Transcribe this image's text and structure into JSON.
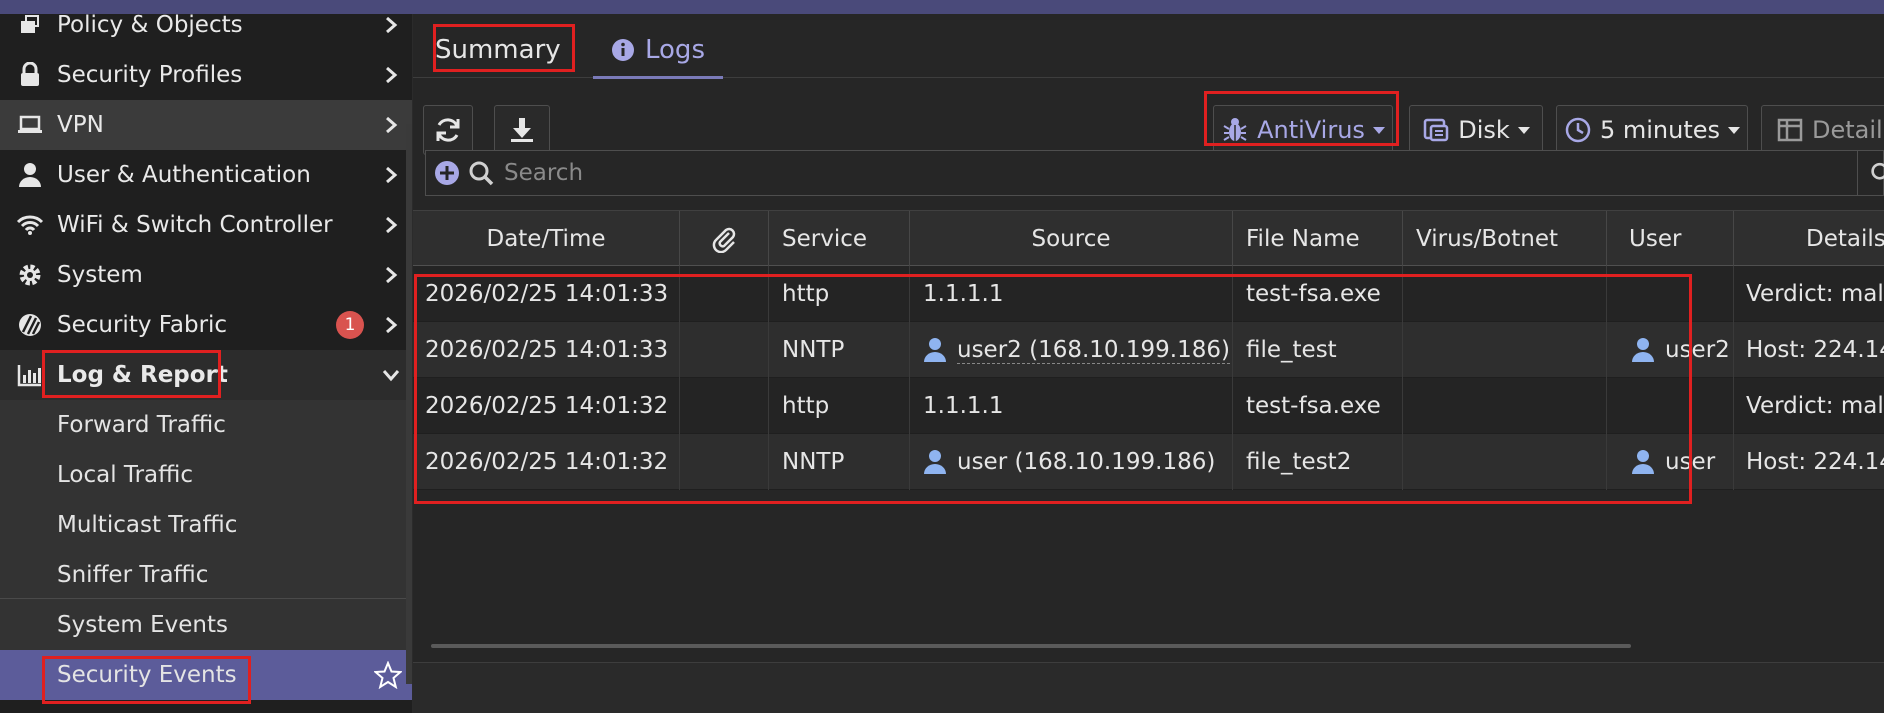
{
  "sidebar": {
    "items": [
      {
        "label": "Policy & Objects",
        "icon": "policy-icon"
      },
      {
        "label": "Security Profiles",
        "icon": "lock-icon"
      },
      {
        "label": "VPN",
        "icon": "laptop-icon"
      },
      {
        "label": "User & Authentication",
        "icon": "user-icon"
      },
      {
        "label": "WiFi & Switch Controller",
        "icon": "wifi-icon"
      },
      {
        "label": "System",
        "icon": "gear-icon"
      },
      {
        "label": "Security Fabric",
        "icon": "fabric-icon",
        "badge": "1"
      },
      {
        "label": "Log & Report",
        "icon": "chart-icon"
      }
    ],
    "sub_items": [
      {
        "label": "Forward Traffic"
      },
      {
        "label": "Local Traffic"
      },
      {
        "label": "Multicast Traffic"
      },
      {
        "label": "Sniffer Traffic"
      },
      {
        "label": "System Events"
      },
      {
        "label": "Security Events"
      }
    ]
  },
  "tabs": {
    "summary": "Summary",
    "logs": "Logs"
  },
  "toolbar": {
    "antivirus": "AntiVirus",
    "disk": "Disk",
    "time": "5 minutes",
    "details": "Details"
  },
  "search": {
    "placeholder": "Search"
  },
  "table": {
    "columns": [
      "Date/Time",
      "",
      "Service",
      "Source",
      "File Name",
      "Virus/Botnet",
      "User",
      "Details"
    ],
    "rows": [
      {
        "datetime": "2026/02/25 14:01:33",
        "service": "http",
        "source": "1.1.1.1",
        "source_user": false,
        "file": "test-fsa.exe",
        "virus": "",
        "user": "",
        "details": "Verdict: malic"
      },
      {
        "datetime": "2026/02/25 14:01:33",
        "service": "NNTP",
        "source": "user2 (168.10.199.186)",
        "source_user": true,
        "file": "file_test",
        "virus": "",
        "user": "user2",
        "details": "Host: 224.14"
      },
      {
        "datetime": "2026/02/25 14:01:32",
        "service": "http",
        "source": "1.1.1.1",
        "source_user": false,
        "file": "test-fsa.exe",
        "virus": "",
        "user": "",
        "details": "Verdict: malic"
      },
      {
        "datetime": "2026/02/25 14:01:32",
        "service": "NNTP",
        "source": "user (168.10.199.186)",
        "source_user": true,
        "file": "file_test2",
        "virus": "",
        "user": "user",
        "details": "Host: 224.14"
      }
    ]
  },
  "colors": {
    "accent": "#a8a8e6",
    "active_nav": "#5c5c9a",
    "badge": "#d9534f",
    "highlight": "#e02020",
    "user_icon": "#8fb4f0"
  }
}
